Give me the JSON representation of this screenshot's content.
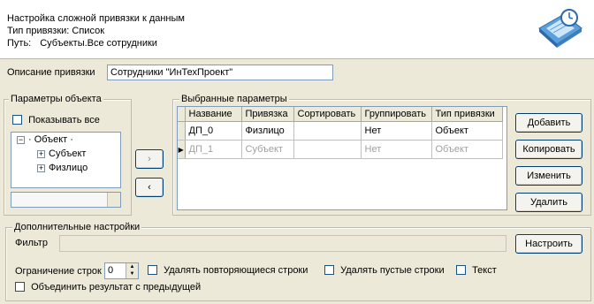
{
  "header": {
    "title": "Настройка сложной привязки к данным",
    "binding_type": "Тип привязки: Список",
    "path_label": "Путь:",
    "path_value": "Субъекты.Все сотрудники"
  },
  "description": {
    "label": "Описание привязки",
    "value": "Сотрудники \"ИнТехПроект\""
  },
  "object_params": {
    "legend": "Параметры объекта",
    "show_all_label": "Показывать все",
    "tree": {
      "root": "Объект",
      "children": [
        "Субъект",
        "Физлицо"
      ]
    }
  },
  "selected_params": {
    "legend": "Выбранные параметры",
    "columns": [
      "Название",
      "Привязка",
      "Сортировать",
      "Группировать",
      "Тип привязки"
    ],
    "rows": [
      [
        "ДП_0",
        "Физлицо",
        "",
        "Нет",
        "Объект"
      ],
      [
        "ДП_1",
        "Субъект",
        "",
        "Нет",
        "Объект"
      ]
    ]
  },
  "transfer": {
    "add_symbol": "›",
    "remove_symbol": "‹"
  },
  "buttons": {
    "add": "Добавить",
    "copy": "Копировать",
    "edit": "Изменить",
    "delete": "Удалить"
  },
  "extra": {
    "legend": "Дополнительные настройки",
    "filter_label": "Фильтр",
    "filter_value": "",
    "configure": "Настроить",
    "row_limit_label": "Ограничение строк",
    "row_limit_value": "0",
    "remove_duplicates": "Удалять повторяющиеся строки",
    "remove_empty": "Удалять пустые строки",
    "text": "Текст",
    "merge": "Объединить результат с предыдущей"
  }
}
